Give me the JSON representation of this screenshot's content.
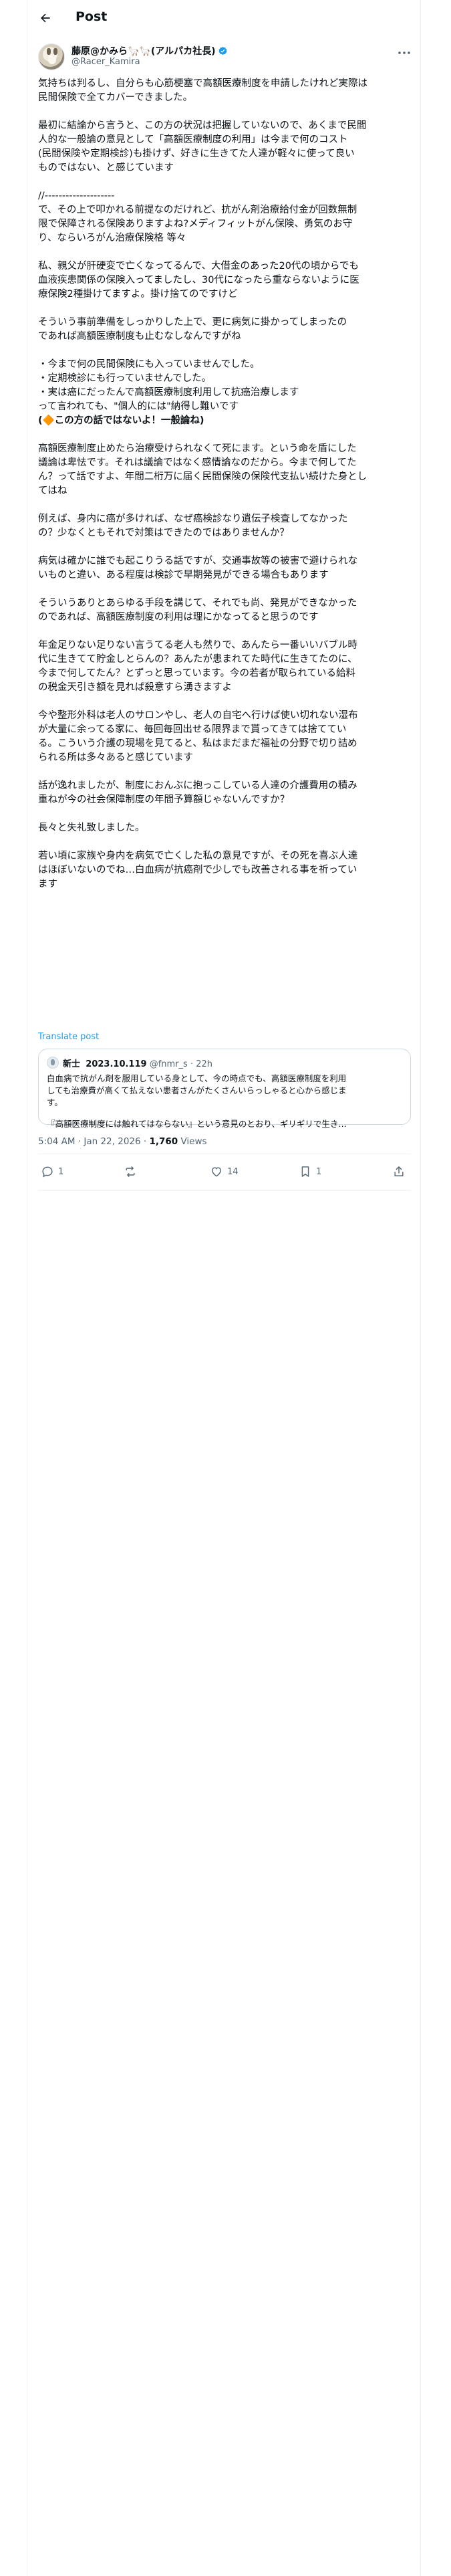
{
  "header": {
    "title": "Post",
    "back_icon": "arrow-left-icon"
  },
  "author": {
    "name": "藤原@かみら🦙🦙(アルパカ社長)",
    "handle": "@Racer_Kamira",
    "avatar_icon": "alpaca-avatar",
    "verified_icon": "verified-badge-icon",
    "verified_color": "#1d9bf0"
  },
  "post": {
    "lines": [
      "気持ちは判るし、自分らも心筋梗塞で高額医療制度を申請したけれど実際は",
      "民間保険で全てカバーできました。",
      "",
      "最初に結論から言うと、この方の状況は把握していないので、あくまで民間",
      "人的な一般論の意見として「高額医療制度の利用」は今まで何のコスト",
      "(民間保険や定期検診)も掛けず、好きに生きてた人達が軽々に使って良い",
      "ものではない、と感じています",
      "",
      "//--------------------",
      "で、その上で叩かれる前提なのだけれど、抗がん剤治療給付金が回数無制",
      "限で保障される保険ありますよね?メディフィットがん保険、勇気のお守",
      "り、ならいろがん治療保険格 等々",
      "",
      "私、親父が肝硬変で亡くなってるんで、大借金のあった20代の頃からでも",
      "血液疾患関係の保険入ってましたし、30代になったら重ならないように医",
      "療保険2種掛けてますよ。掛け捨てのですけど",
      "",
      "そういう事前準備をしっかりした上で、更に病気に掛かってしまったの",
      "であれば高額医療制度も止むなしなんですがね",
      "",
      "・今まで何の民間保険にも入っていませんでした。",
      "・定期検診にも行っていませんでした。",
      "・実は癌にだったんで高額医療制度利用して抗癌治療します",
      "って言われても、\"個人的には\"納得し難いです",
      "(🔶この方の話ではないよ！一般論ね)",
      "",
      "高額医療制度止めたら治療受けられなくて死にます。という命を盾にした",
      "議論は卑怯です。それは議論ではなく感情論なのだから。今まで何してた",
      "ん？って話ですよ、年間二桁万に届く民間保険の保険代支払い続けた身とし",
      "てはね",
      "",
      "例えば、身内に癌が多ければ、なぜ癌検診なり遺伝子検査してなかった",
      "の？少なくともそれで対策はできたのではありませんか？",
      "",
      "病気は確かに誰でも起こりうる話ですが、交通事故等の被害で避けられな",
      "いものと違い、ある程度は検診で早期発見ができる場合もあります",
      "",
      "そういうありとあらゆる手段を講じて、それでも尚、発見ができなかった",
      "のであれば、高額医療制度の利用は理にかなってると思うのです",
      "",
      "年金足りない足りない言うてる老人も然りで、あんたら一番いいバブル時",
      "代に生きてて貯金しとらんの？あんたが患まれてた時代に生きてたのに、",
      "今まで何してたん？とずっと思っています。今の若者が取られている給料",
      "の税金天引き額を見れば殺意すら湧きますよ",
      "",
      "今や整形外科は老人のサロンやし、老人の自宅へ行けば使い切れない湿布",
      "が大量に余ってる家に、毎回毎回出せる限界まで貰ってきては捨ててい",
      "る。こういう介護の現場を見てると、私はまだまだ福祉の分野で切り詰め",
      "られる所は多々あると感じています",
      "",
      "話が逸れましたが、制度におんぶに抱っこしている人達の介護費用の積み",
      "重ねが今の社会保障制度の年間予算額じゃないんですか？",
      "",
      "長々と失礼致しました。",
      "",
      "若い頃に家族や身内を病気で亡くした私の意見ですが、その死を喜ぶ人達",
      "はほぼいないのでね…白血病が抗癌剤で少しでも改善される事を祈ってい",
      "ます"
    ],
    "translate_label": "Translate post"
  },
  "quote": {
    "author_name": "新士",
    "date_label": "2023.10.119",
    "handle": "@fnmr_s",
    "time": "· 22h",
    "lines": [
      "白血病で抗がん剤を服用している身として、今の時点でも、高額医療制度を利用",
      "しても治療費が高くて払えない患者さんがたくさんいらっしゃると心から感じま",
      "す。",
      "",
      "『高額医療制度には触れてはならない』という意見のとおり、ギリギリで生き…"
    ]
  },
  "meta": {
    "time": "5:04 AM · Jan 22, 2026 · ",
    "views": "1,760",
    "views_label": " Views"
  },
  "actions": {
    "reply_count": "1",
    "repost_count": "",
    "like_count": "14",
    "bookmark_count": "1",
    "icons": [
      "reply-icon",
      "repost-icon",
      "like-icon",
      "bookmark-icon",
      "share-icon"
    ]
  },
  "colors": {
    "text": "#0f1419",
    "secondary": "#536471",
    "link": "#1d9bf0",
    "border": "#cfd9de"
  }
}
